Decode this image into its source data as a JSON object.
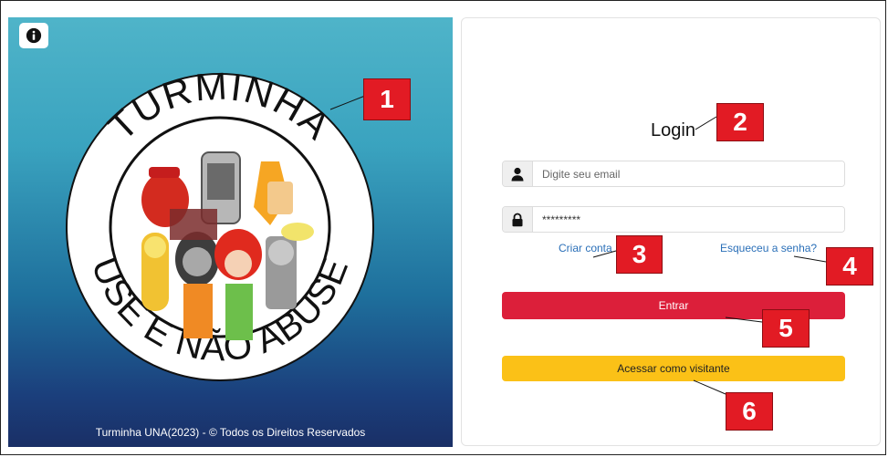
{
  "left_panel": {
    "info_icon": "info-circle-icon",
    "logo": {
      "top_text": "TURMINHA",
      "bottom_text": "USE E NÃO ABUSE"
    },
    "footer_text": "Turminha UNA(2023) - © Todos os Direitos Reservados",
    "colors": {
      "gradient_top": "#4fb4c9",
      "gradient_bottom": "#1a2f66"
    }
  },
  "login_panel": {
    "title": "Login",
    "email": {
      "icon": "user-icon",
      "placeholder": "Digite seu email",
      "value": ""
    },
    "password": {
      "icon": "lock-icon",
      "value": "*********"
    },
    "create_account_link": "Criar conta",
    "forgot_password_link": "Esqueceu a senha?",
    "enter_button": "Entrar",
    "guest_button": "Acessar como visitante",
    "colors": {
      "enter_button": "#dc1f3a",
      "guest_button": "#fbc117",
      "link": "#2a6fb8"
    }
  },
  "annotations": {
    "markers": [
      "1",
      "2",
      "3",
      "4",
      "5",
      "6"
    ],
    "color": "#e21b24"
  }
}
